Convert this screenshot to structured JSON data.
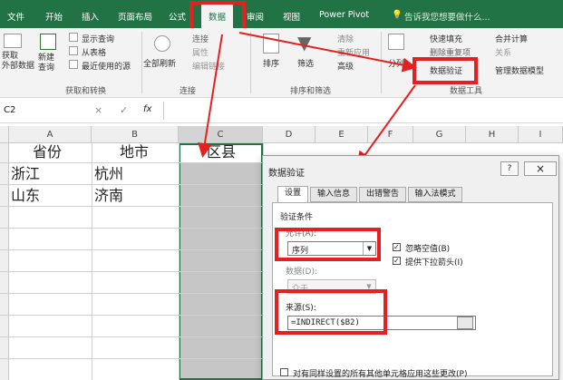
{
  "tabs": [
    "文件",
    "开始",
    "插入",
    "页面布局",
    "公式",
    "数据",
    "审阅",
    "视图",
    "Power Pivot"
  ],
  "tell_me": "告诉我您想要做什么...",
  "ribbon": {
    "get_data": "获取\n外部数据",
    "new_query": "新建\n查询",
    "show_queries": "显示查询",
    "from_table": "从表格",
    "recent_sources": "最近使用的源",
    "group_get_transform": "获取和转换",
    "refresh_all": "全部刷新",
    "connections": "连接",
    "properties": "属性",
    "edit_links": "编辑链接",
    "group_connections": "连接",
    "sort": "排序",
    "filter": "筛选",
    "clear": "清除",
    "reapply": "重新应用",
    "advanced": "高级",
    "group_sort_filter": "排序和筛选",
    "text_to_columns": "分列",
    "flash_fill": "快速填充",
    "remove_duplicates": "删除重复项",
    "data_validation": "数据验证",
    "consolidate": "合并计算",
    "relationships": "关系",
    "manage_data_model": "管理数据模型",
    "group_data_tools": "数据工具"
  },
  "formula_bar": {
    "name_box": "C2",
    "cancel": "×",
    "enter": "✓",
    "fx": "fx",
    "value": ""
  },
  "sheet": {
    "columns": [
      "A",
      "B",
      "C",
      "D",
      "E",
      "F",
      "G",
      "H",
      "I"
    ],
    "headers": [
      "省份",
      "地市",
      "区县"
    ],
    "rows": [
      [
        "浙江",
        "杭州"
      ],
      [
        "山东",
        "济南"
      ]
    ]
  },
  "dialog": {
    "title": "数据验证",
    "help": "?",
    "close": "×",
    "tabs": [
      "设置",
      "输入信息",
      "出错警告",
      "输入法模式"
    ],
    "criteria_label": "验证条件",
    "allow_label": "允许(A):",
    "allow_value": "序列",
    "ignore_blank": "忽略空值(B)",
    "in_cell_dropdown": "提供下拉箭头(I)",
    "data_label": "数据(D):",
    "data_value": "介于",
    "source_label": "来源(S):",
    "source_value": "=INDIRECT($B2)",
    "apply_all": "对有同样设置的所有其他单元格应用这些更改(P)"
  },
  "colors": {
    "excel_green": "#217346",
    "highlight_red": "#e52020",
    "selected_col": "#c6c6c6"
  }
}
